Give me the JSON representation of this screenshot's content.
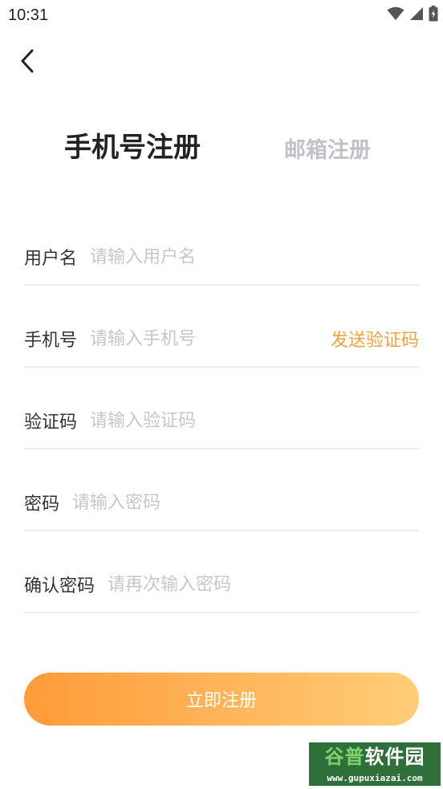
{
  "status_bar": {
    "time": "10:31",
    "icons": [
      "wifi-icon",
      "cellular-signal-icon",
      "battery-charging-icon"
    ]
  },
  "navigation": {
    "back_icon": "chevron-left-icon"
  },
  "tabs": [
    {
      "label": "手机号注册",
      "active": true
    },
    {
      "label": "邮箱注册",
      "active": false
    }
  ],
  "form": {
    "username": {
      "label": "用户名",
      "placeholder": "请输入用户名",
      "value": ""
    },
    "phone": {
      "label": "手机号",
      "placeholder": "请输入手机号",
      "value": "",
      "action_label": "发送验证码"
    },
    "code": {
      "label": "验证码",
      "placeholder": "请输入验证码",
      "value": ""
    },
    "password": {
      "label": "密码",
      "placeholder": "请输入密码",
      "value": ""
    },
    "confirm_password": {
      "label": "确认密码",
      "placeholder": "请再次输入密码",
      "value": ""
    }
  },
  "submit": {
    "label": "立即注册"
  },
  "watermark": {
    "title_part1": "谷普",
    "title_part2": "软件园",
    "url": "www.gupuxiazai.com"
  },
  "colors": {
    "accent": "#f5a13c",
    "gradient_start": "#ff9b39",
    "gradient_end": "#ffcd78",
    "inactive_tab": "#bfc2c8",
    "placeholder": "#c4c7cc",
    "divider": "#ececec"
  }
}
